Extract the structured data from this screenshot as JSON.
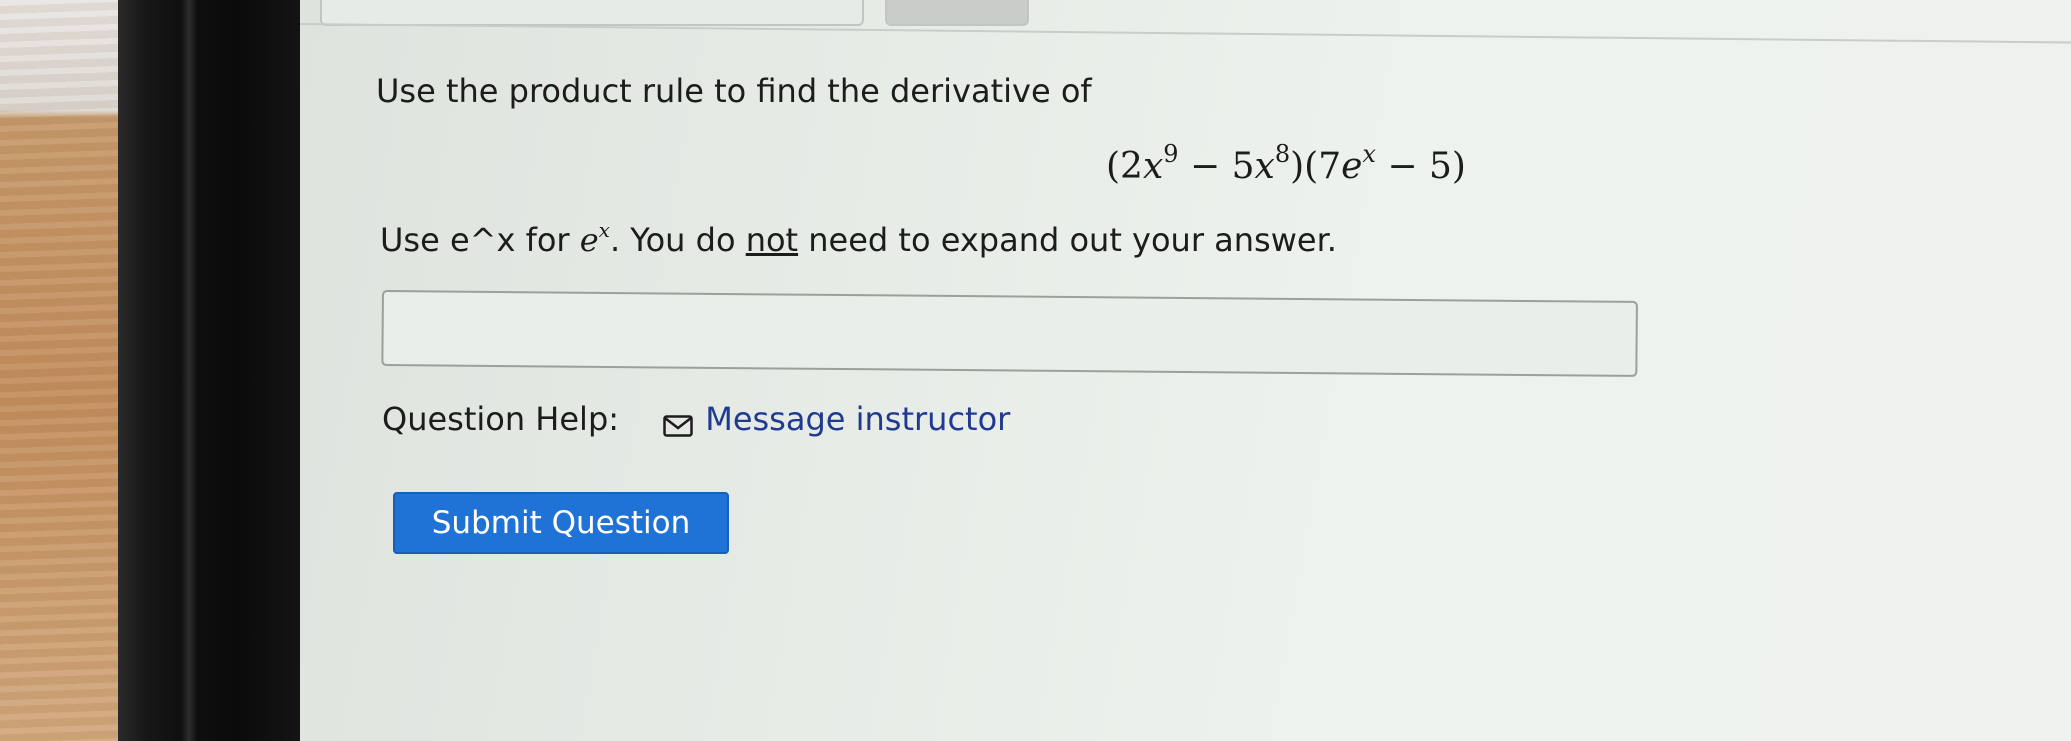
{
  "question": {
    "prompt": "Use the product rule to find the derivative of",
    "formula": {
      "open1": "(2",
      "var1": "x",
      "exp1": "9",
      "mid1": " − 5",
      "var2": "x",
      "exp2": "8",
      "mid2": ")(7",
      "var3": "e",
      "exp3": "x",
      "end": " − 5)"
    },
    "instruction": {
      "part1": "Use e^x for ",
      "math_base": "e",
      "math_exp": "x",
      "part2": ". You do ",
      "emphasis": "not",
      "part3": " need to expand out your answer."
    }
  },
  "answer": {
    "value": ""
  },
  "help": {
    "label": "Question Help:",
    "message_link": "Message instructor",
    "icon": "mail-icon"
  },
  "submit": {
    "label": "Submit Question"
  },
  "colors": {
    "button": "#1f73d6",
    "link": "#1f3a8f",
    "screen_bg": "#eaeeea"
  }
}
